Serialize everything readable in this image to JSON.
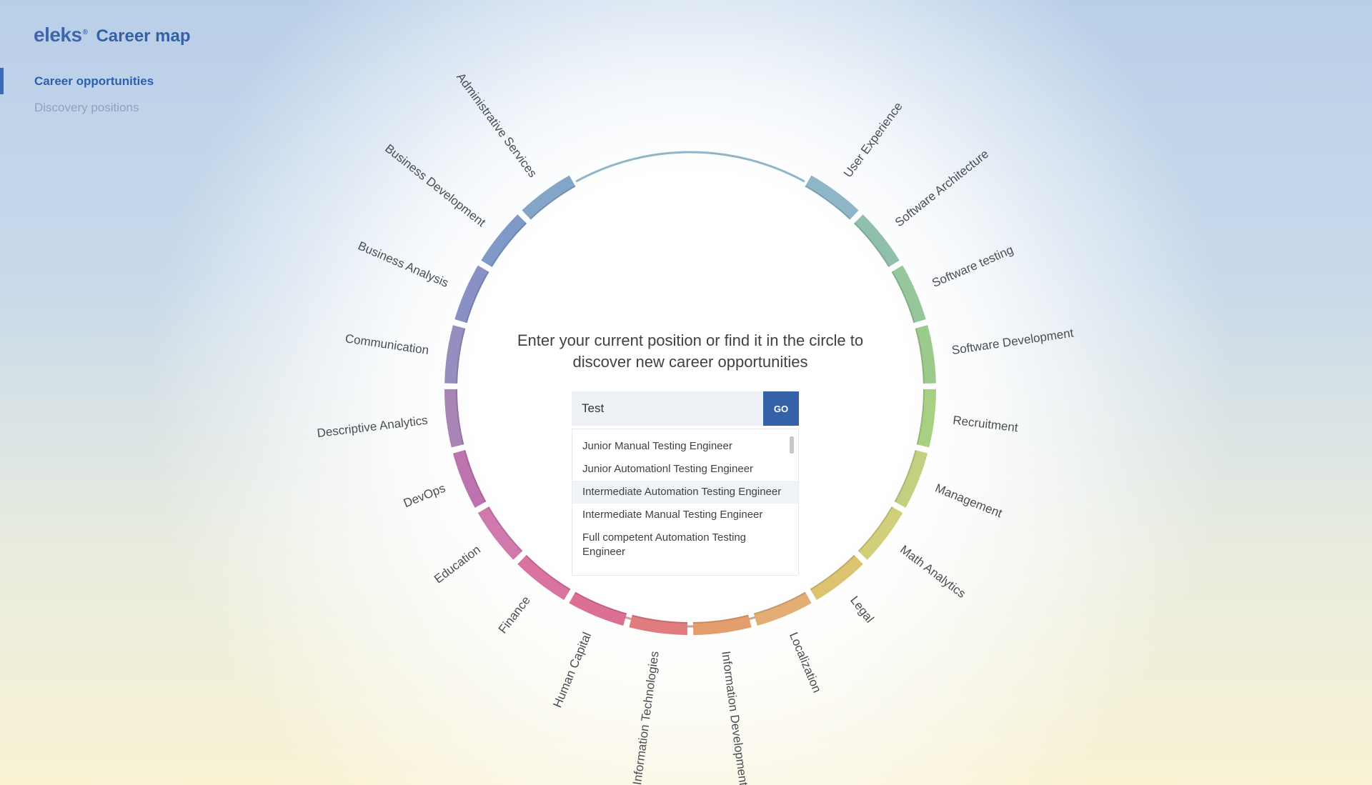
{
  "brand": {
    "logo": "eleks",
    "logo_mark": "®",
    "title": "Career map"
  },
  "nav": {
    "items": [
      {
        "label": "Career opportunities",
        "active": true
      },
      {
        "label": "Discovery positions",
        "active": false
      }
    ]
  },
  "wheel": {
    "segments": [
      {
        "label": "User Experience",
        "color": "#8eb6c6"
      },
      {
        "label": "Software Architecture",
        "color": "#8fc0ab"
      },
      {
        "label": "Software testing",
        "color": "#95c69c"
      },
      {
        "label": "Software Development",
        "color": "#9bcb8c"
      },
      {
        "label": "Recruitment",
        "color": "#a8d083"
      },
      {
        "label": "Management",
        "color": "#c3d080"
      },
      {
        "label": "Math Analytics",
        "color": "#d2cf7b"
      },
      {
        "label": "Legal",
        "color": "#dcc36f"
      },
      {
        "label": "Localization",
        "color": "#e3ad74"
      },
      {
        "label": "Information Development",
        "color": "#e49e6e"
      },
      {
        "label": "Information Technologies",
        "color": "#e07c80"
      },
      {
        "label": "Human Capital",
        "color": "#dc7092"
      },
      {
        "label": "Finance",
        "color": "#d974a1"
      },
      {
        "label": "Education",
        "color": "#d179ac"
      },
      {
        "label": "DevOps",
        "color": "#bd73ad"
      },
      {
        "label": "Descriptive Analytics",
        "color": "#a884b7"
      },
      {
        "label": "Communication",
        "color": "#968ebe"
      },
      {
        "label": "Business Analysis",
        "color": "#8890c5"
      },
      {
        "label": "Business Development",
        "color": "#7f9ac8"
      },
      {
        "label": "Administrative Services",
        "color": "#83a5c7"
      }
    ]
  },
  "prompt": {
    "line1": "Enter your current position or find it in the circle to",
    "line2": "discover new career opportunities"
  },
  "search": {
    "value": "Test",
    "go_label": "GO"
  },
  "suggestions": [
    "Junior Manual Testing Engineer",
    "Junior Automationl Testing Engineer",
    "Intermediate Automation Testing Engineer",
    "Intermediate Manual Testing Engineer",
    "Full competent Automation Testing Engineer"
  ]
}
